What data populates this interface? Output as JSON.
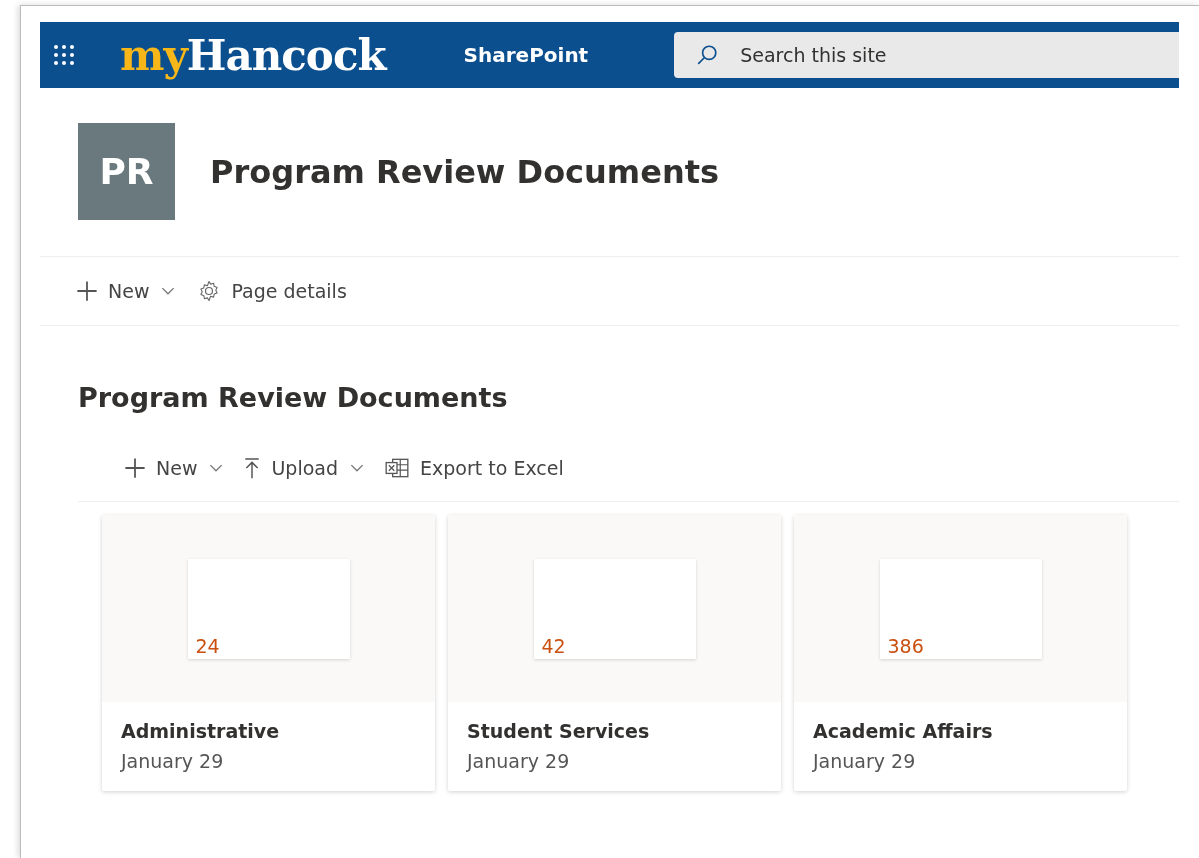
{
  "header": {
    "logo": {
      "accent": "my",
      "text": "Hancock"
    },
    "app_name": "SharePoint",
    "search": {
      "placeholder": "Search this site"
    }
  },
  "site": {
    "initials": "PR",
    "title": "Program Review Documents"
  },
  "command_bar": [
    {
      "kind": "new",
      "label": "New"
    },
    {
      "kind": "details",
      "label": "Page details"
    }
  ],
  "library": {
    "title": "Program Review Documents",
    "commands": [
      {
        "kind": "new",
        "label": "New"
      },
      {
        "kind": "upload",
        "label": "Upload"
      },
      {
        "kind": "excel",
        "label": "Export to Excel"
      }
    ],
    "folders": [
      {
        "name": "Administrative",
        "date": "January 29",
        "count": "24"
      },
      {
        "name": "Student Services",
        "date": "January 29",
        "count": "42"
      },
      {
        "name": "Academic Affairs",
        "date": "January 29",
        "count": "386"
      }
    ]
  }
}
